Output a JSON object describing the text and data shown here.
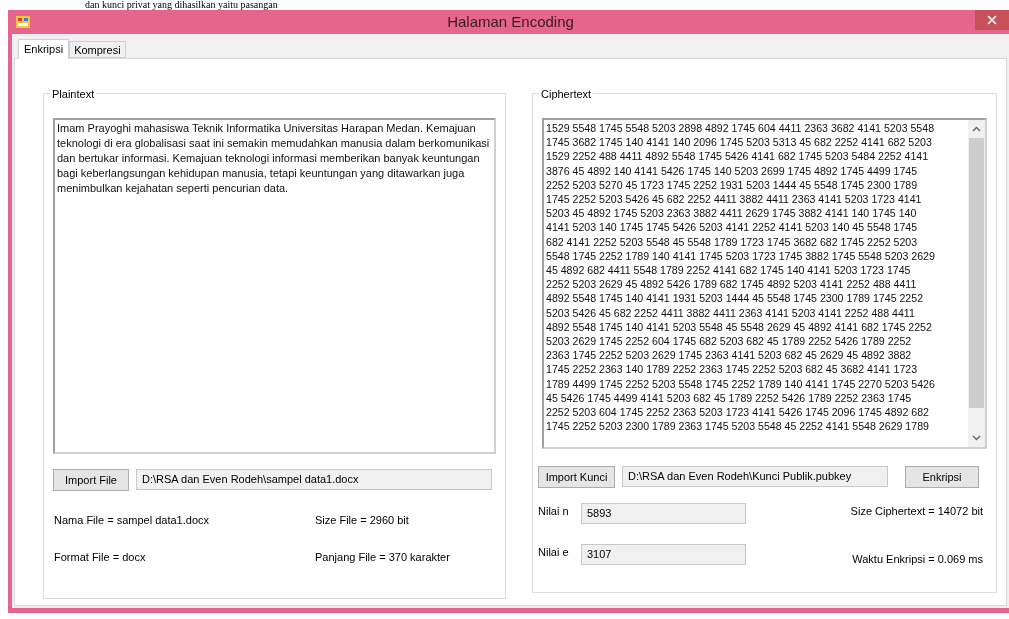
{
  "document_fragment": "dan kunci privat yang dihasilkan yaitu pasangan",
  "window": {
    "title": "Halaman Encoding"
  },
  "tabs": [
    {
      "label": "Enkripsi",
      "selected": true
    },
    {
      "label": "Kompresi",
      "selected": false
    }
  ],
  "plaintext_group": {
    "label": "Plaintext",
    "text": "Imam Prayoghi mahasiswa Teknik Informatika Universitas Harapan Medan. Kemajuan teknologi di era globalisasi saat ini semakin memudahkan manusia dalam berkomunikasi dan bertukar informasi. Kemajuan teknologi informasi memberikan banyak keuntungan bagi keberlangsungan kehidupan manusia, tetapi keuntungan yang ditawarkan juga menimbulkan kejahatan seperti pencurian data.",
    "import_button": "Import File",
    "file_path": "D:\\RSA dan Even Rodeh\\sampel data1.docx",
    "info_rows": [
      {
        "left": "Nama File = sampel data1.docx",
        "right": "Size File = 2960 bit"
      },
      {
        "left": "Format File = docx",
        "right": "Panjang File = 370 karakter"
      }
    ]
  },
  "ciphertext_group": {
    "label": "Ciphertext",
    "lines": [
      "1529 5548 1745 5548 5203 2898 4892 1745 604 4411 2363 3682 4141 5203 5548",
      "1745 3682 1745 140 4141 140 2096 1745 5203 5313 45 682 2252 4141 682 5203",
      "1529 2252 488 4411 4892 5548 1745 5426 4141 682 1745 5203 5484 2252 4141",
      "3876 45 4892 140 4141 5426 1745 140 5203 2699 1745 4892 1745 4499 1745",
      "2252 5203 5270 45 1723 1745 2252 1931 5203 1444 45 5548 1745 2300 1789",
      "1745 2252 5203 5426 45 682 2252 4411 3882 4411 2363 4141 5203 1723 4141",
      "5203 45 4892 1745 5203 2363 3882 4411 2629 1745 3882 4141 140 1745 140",
      "4141 5203 140 1745 1745 5426 5203 4141 2252 4141 5203 140 45 5548 1745",
      "682 4141 2252 5203 5548 45 5548 1789 1723 1745 3682 682 1745 2252 5203",
      "5548 1745 2252 1789 140 4141 1745 5203 1723 1745 3882 1745 5548 5203 2629",
      "45 4892 682 4411 5548 1789 2252 4141 682 1745 140 4141 5203 1723 1745",
      "2252 5203 2629 45 4892 5426 1789 682 1745 4892 5203 4141 2252 488 4411",
      "4892 5548 1745 140 4141 1931 5203 1444 45 5548 1745 2300 1789 1745 2252",
      "5203 5426 45 682 2252 4411 3882 4411 2363 4141 5203 4141 2252 488 4411",
      "4892 5548 1745 140 4141 5203 5548 45 5548 2629 45 4892 4141 682 1745 2252",
      "5203 2629 1745 2252 604 1745 682 5203 682 45 1789 2252 5426 1789 2252",
      "2363 1745 2252 5203 2629 1745 2363 4141 5203 682 45 2629 45 4892 3882",
      "1745 2252 2363 140 1789 2252 2363 1745 2252 5203 682 45 3682 4141 1723",
      "1789 4499 1745 2252 5203 5548 1745 2252 1789 140 4141 1745 2270 5203 5426",
      "45 5426 1745 4499 4141 5203 682 45 1789 2252 5426 1789 2252 2363 1745",
      "2252 5203 604 1745 2252 2363 5203 1723 4141 5426 1745 2096 1745 4892 682",
      "1745 2252 5203 2300 1789 2363 1745 5203 5548 45 2252 4141 5548 2629 1789"
    ],
    "import_button": "Import Kunci",
    "key_path": "D:\\RSA dan Even Rodeh\\Kunci Publik.pubkey",
    "encrypt_button": "Enkripsi",
    "fields": [
      {
        "label": "Nilai n",
        "value": "5893",
        "result": "Size Ciphertext = 14072 bit"
      },
      {
        "label": "Nilai e",
        "value": "3107",
        "result": "Waktu Enkripsi = 0.069 ms"
      }
    ]
  }
}
